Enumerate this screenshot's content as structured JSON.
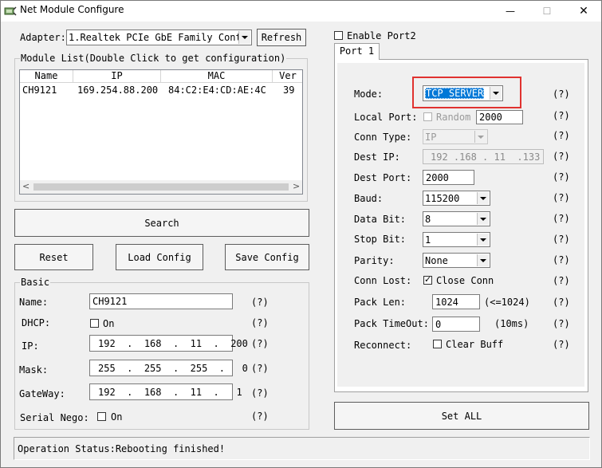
{
  "window": {
    "title": "Net Module Configure",
    "minimize_glyph": "—",
    "maximize_glyph": "☐",
    "close_glyph": "✕"
  },
  "adapter": {
    "label": "Adapter:",
    "selected": "1.Realtek PCIe GbE Family Cont:",
    "refresh_label": "Refresh"
  },
  "module_list": {
    "title": "Module List(Double Click to get configuration)",
    "columns": [
      "Name",
      "IP",
      "MAC",
      "Ver"
    ],
    "rows": [
      {
        "name": "CH9121",
        "ip": "169.254.88.200",
        "mac": "84:C2:E4:CD:AE:4C",
        "ver": "39"
      }
    ],
    "scroll_left": "<",
    "scroll_right": ">"
  },
  "buttons": {
    "search": "Search",
    "reset": "Reset",
    "load_config": "Load Config",
    "save_config": "Save Config",
    "set_all": "Set ALL"
  },
  "basic": {
    "title": "Basic",
    "name_label": "Name:",
    "name_value": "CH9121",
    "dhcp_label": "DHCP:",
    "dhcp_option": "On",
    "dhcp_checked": false,
    "ip_label": "IP:",
    "ip": [
      "192",
      "168",
      "11",
      "200"
    ],
    "mask_label": "Mask:",
    "mask": [
      "255",
      "255",
      "255",
      "0"
    ],
    "gateway_label": "GateWay:",
    "gateway": [
      "192",
      "168",
      "11",
      "1"
    ],
    "serial_nego_label": "Serial Nego:",
    "serial_nego_option": "On",
    "serial_nego_checked": false,
    "help": "(?)"
  },
  "port": {
    "enable_port2_label": "Enable Port2",
    "enable_port2_checked": false,
    "tab_label": "Port 1",
    "mode_label": "Mode:",
    "mode_value": "TCP SERVER",
    "local_port_label": "Local Port:",
    "random_label": "Random",
    "random_checked": false,
    "local_port_value": "2000",
    "conn_type_label": "Conn Type:",
    "conn_type_value": "IP",
    "dest_ip_label": "Dest IP:",
    "dest_ip": [
      "192",
      "168",
      "11",
      "133"
    ],
    "dest_port_label": "Dest Port:",
    "dest_port_value": "2000",
    "baud_label": "Baud:",
    "baud_value": "115200",
    "data_bit_label": "Data Bit:",
    "data_bit_value": "8",
    "stop_bit_label": "Stop Bit:",
    "stop_bit_value": "1",
    "parity_label": "Parity:",
    "parity_value": "None",
    "conn_lost_label": "Conn Lost:",
    "close_conn_label": "Close Conn",
    "close_conn_checked": true,
    "pack_len_label": "Pack Len:",
    "pack_len_value": "1024",
    "pack_len_hint": "(<=1024)",
    "pack_timeout_label": "Pack TimeOut:",
    "pack_timeout_value": "0",
    "pack_timeout_hint": "(10ms)",
    "reconnect_label": "Reconnect:",
    "clear_buff_label": "Clear Buff",
    "clear_buff_checked": false,
    "help": "(?)"
  },
  "status": {
    "text": "Operation Status:Rebooting finished!"
  },
  "colors": {
    "highlight_box": "#e0322f",
    "selection": "#0078d7"
  }
}
